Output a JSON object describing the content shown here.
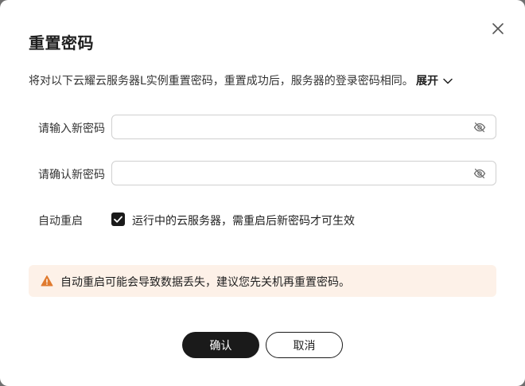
{
  "dialog": {
    "title": "重置密码",
    "description": "将对以下云耀云服务器L实例重置密码，重置成功后，服务器的登录密码相同。",
    "expand_label": "展开"
  },
  "form": {
    "new_password_label": "请输入新密码",
    "new_password_value": "",
    "confirm_password_label": "请确认新密码",
    "confirm_password_value": "",
    "auto_restart_label": "自动重启",
    "auto_restart_checked": true,
    "auto_restart_option": "运行中的云服务器，需重启后新密码才可生效"
  },
  "warning": {
    "text": "自动重启可能会导致数据丢失，建议您先关机再重置密码。",
    "color": "#e07a2e",
    "background": "#fdf1e8"
  },
  "buttons": {
    "confirm": "确认",
    "cancel": "取消"
  },
  "icons": {
    "close": "close-icon",
    "expand": "chevron-down-icon",
    "password_visibility": "eye-off-icon",
    "checkbox": "check-icon",
    "warning": "warning-triangle-icon"
  },
  "colors": {
    "primary_button": "#1a1a1a",
    "checkbox": "#1a1a1a"
  }
}
